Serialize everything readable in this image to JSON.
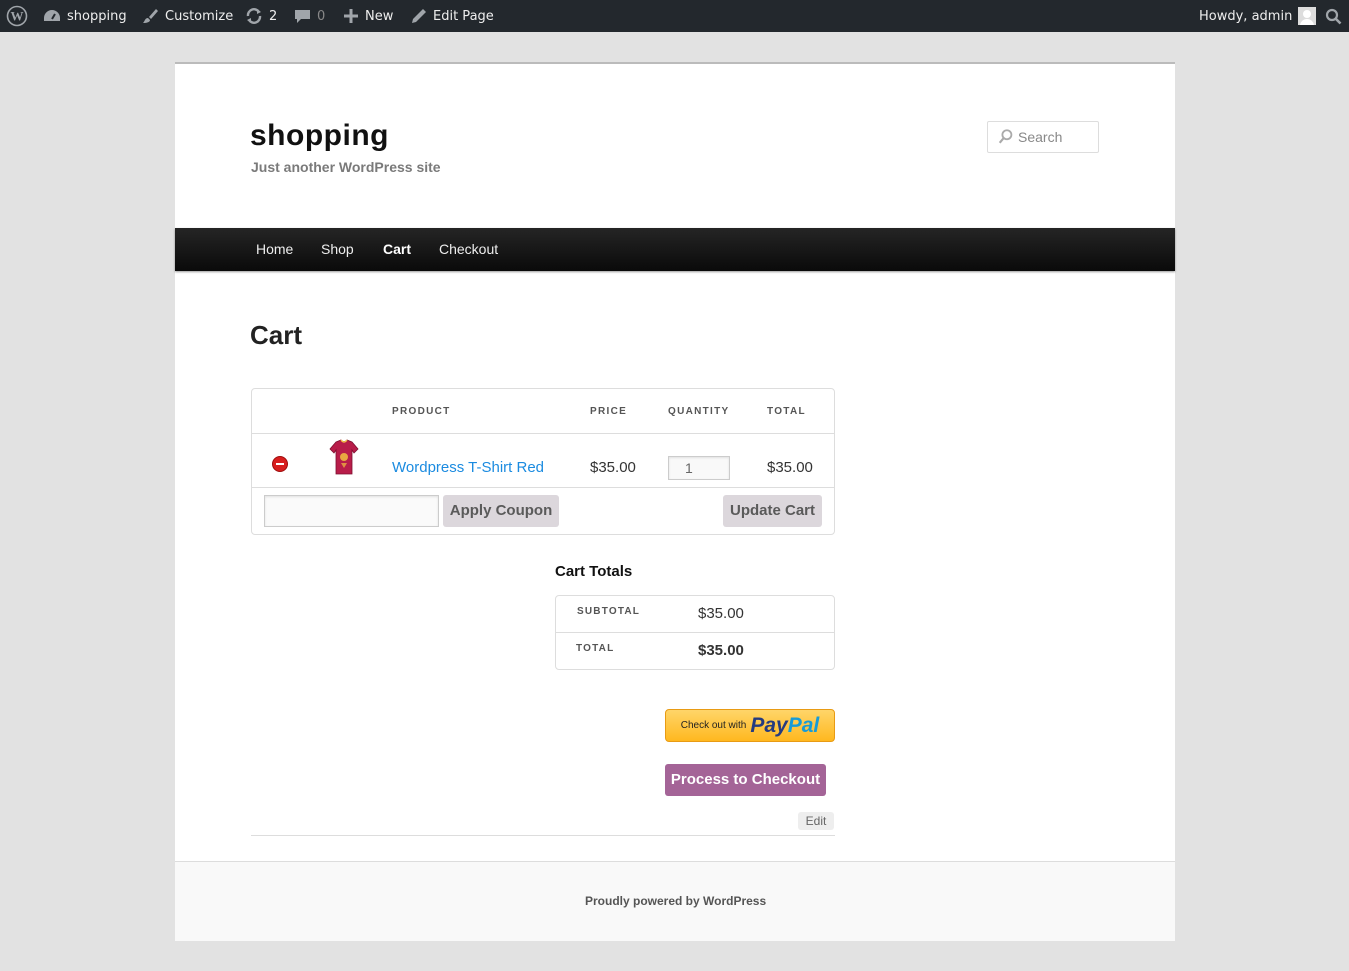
{
  "adminbar": {
    "site_name": "shopping",
    "customize": "Customize",
    "updates_count": "2",
    "comments_count": "0",
    "new_label": "New",
    "edit_page": "Edit Page",
    "howdy": "Howdy, admin"
  },
  "site": {
    "title": "shopping",
    "description": "Just another WordPress site"
  },
  "search": {
    "placeholder": "Search"
  },
  "nav": {
    "items": [
      {
        "label": "Home"
      },
      {
        "label": "Shop"
      },
      {
        "label": "Cart",
        "current": true
      },
      {
        "label": "Checkout"
      }
    ]
  },
  "page": {
    "title": "Cart"
  },
  "cart": {
    "headers": {
      "product": "PRODUCT",
      "price": "PRICE",
      "quantity": "QUANTITY",
      "total": "TOTAL"
    },
    "items": [
      {
        "name": "Wordpress T-Shirt Red",
        "price": "$35.00",
        "quantity": "1",
        "total": "$35.00",
        "thumb_color": "#b81d4a"
      }
    ],
    "apply_coupon_label": "Apply Coupon",
    "update_cart_label": "Update Cart"
  },
  "totals": {
    "title": "Cart Totals",
    "subtotal_label": "SUBTOTAL",
    "subtotal_value": "$35.00",
    "total_label": "TOTAL",
    "total_value": "$35.00"
  },
  "paypal": {
    "prefix": "Check out with",
    "brand_part1": "Pay",
    "brand_part2": "Pal"
  },
  "checkout_button": "Process to Checkout",
  "edit_label": "Edit",
  "footer": {
    "text": "Proudly powered by WordPress"
  },
  "colors": {
    "accent": "#a46497",
    "link": "#1b8be0",
    "adminbar": "#23282d"
  }
}
